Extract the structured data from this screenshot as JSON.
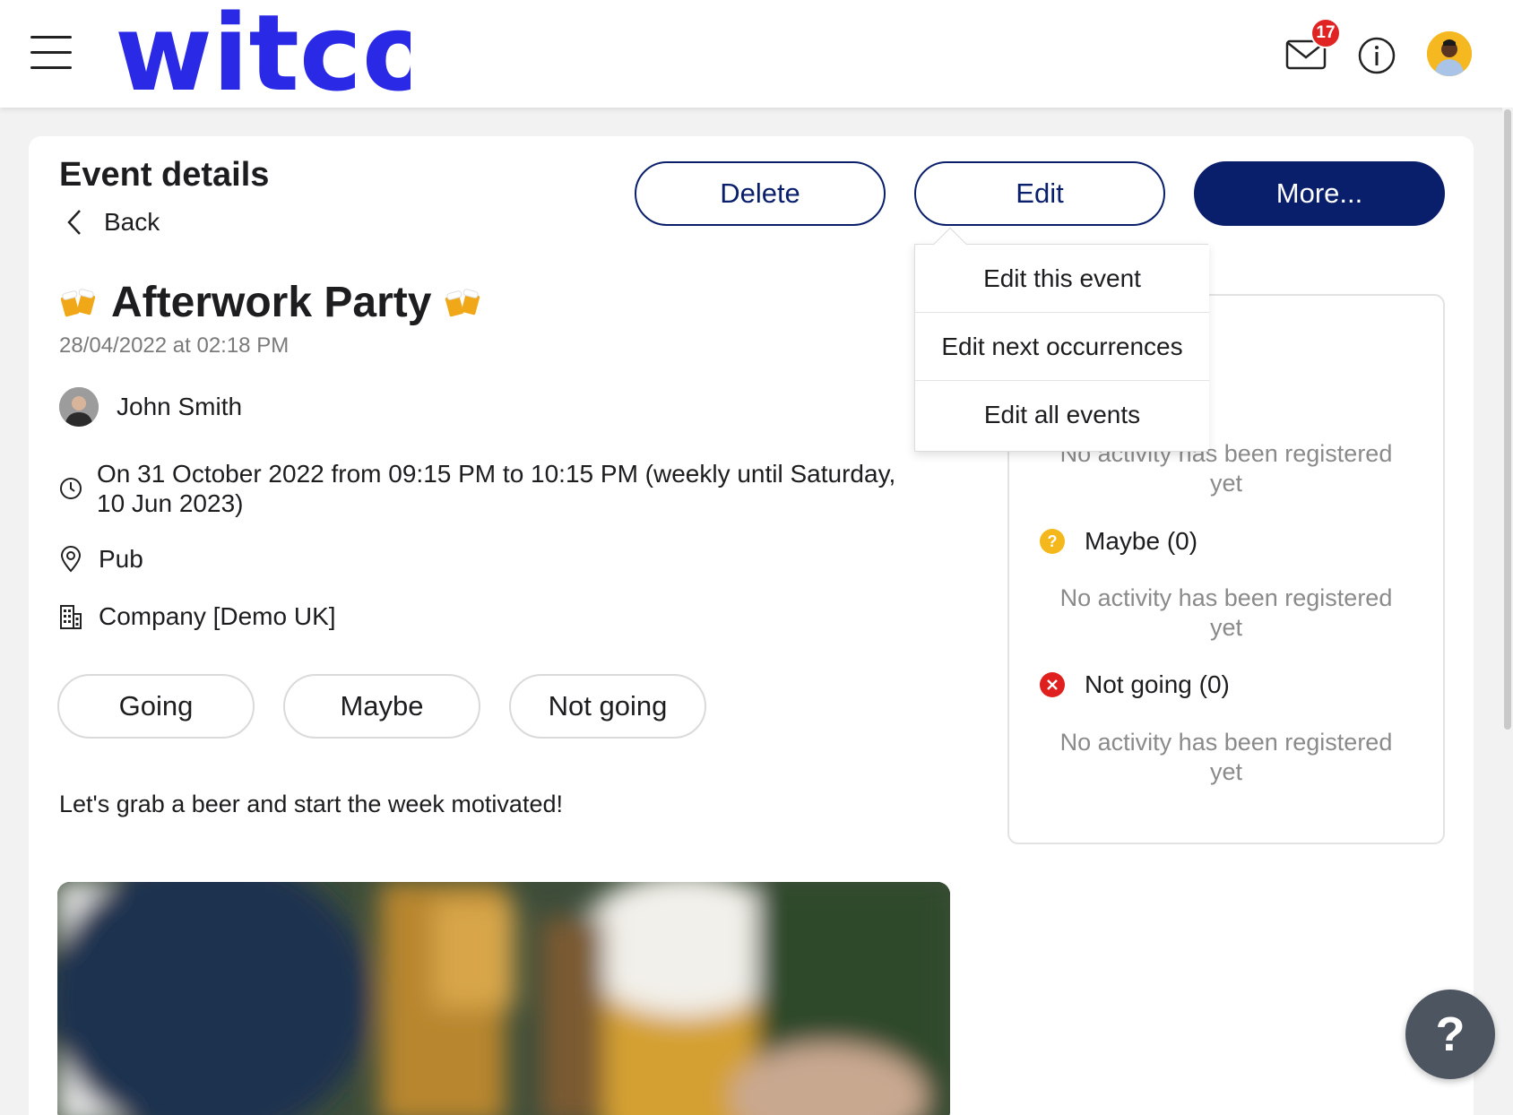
{
  "header": {
    "logo_text": "witco",
    "notifications_count": "17",
    "brand_color": "#2a2ae6"
  },
  "page": {
    "title": "Event details",
    "back_label": "Back"
  },
  "actions": {
    "delete_label": "Delete",
    "edit_label": "Edit",
    "more_label": "More...",
    "accent_color": "#0a1f6b"
  },
  "edit_menu": {
    "items": [
      "Edit this event",
      "Edit next occurrences",
      "Edit all events"
    ]
  },
  "event": {
    "title": "Afterwork Party",
    "emoji_icon": "beer-mugs-icon",
    "created": "28/04/2022 at 02:18 PM",
    "organizer": "John Smith",
    "when_line1": "On 31 October 2022 from 09:15 PM to 10:15 PM (weekly until Saturday,",
    "when_line2": "10 Jun 2023)",
    "location": "Pub",
    "company": "Company [Demo UK]",
    "description": "Let's grab a beer and start the week motivated!"
  },
  "rsvp": {
    "going": "Going",
    "maybe": "Maybe",
    "not_going": "Not going"
  },
  "attendance": {
    "empty_line1": "No activity has been registered",
    "empty_line2": "yet",
    "maybe_label": "Maybe (0)",
    "not_going_label": "Not going (0)"
  },
  "help_label": "?"
}
